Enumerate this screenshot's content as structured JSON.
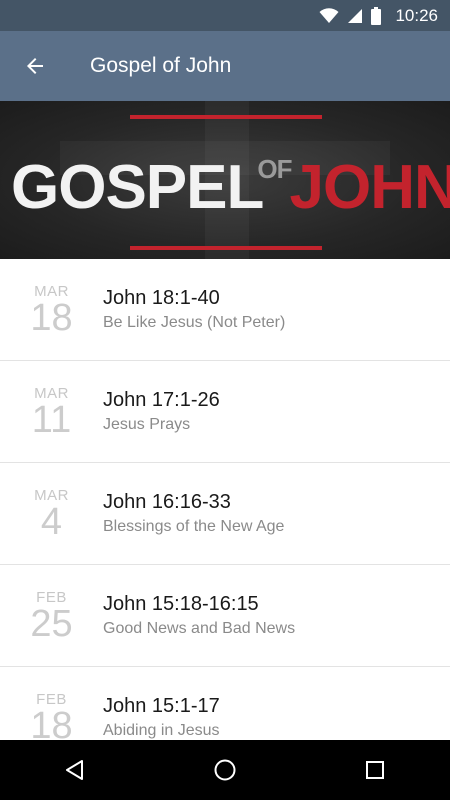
{
  "status_bar": {
    "time": "10:26",
    "icons": [
      "wifi-icon",
      "cell-signal-icon",
      "battery-icon"
    ]
  },
  "app_bar": {
    "title": "Gospel of John",
    "back_icon": "arrow-left-icon"
  },
  "banner": {
    "word1": "GOSPEL",
    "word2": "OF",
    "word3": "JOHN",
    "accent_color": "#c3232d"
  },
  "sermons": [
    {
      "month": "MAR",
      "day": "18",
      "reference": "John 18:1-40",
      "title": "Be Like Jesus (Not Peter)"
    },
    {
      "month": "MAR",
      "day": "11",
      "reference": "John 17:1-26",
      "title": "Jesus Prays"
    },
    {
      "month": "MAR",
      "day": "4",
      "reference": "John 16:16-33",
      "title": "Blessings of the New Age"
    },
    {
      "month": "FEB",
      "day": "25",
      "reference": "John 15:18-16:15",
      "title": "Good News and Bad News"
    },
    {
      "month": "FEB",
      "day": "18",
      "reference": "John 15:1-17",
      "title": "Abiding in Jesus"
    }
  ],
  "nav_bar": {
    "icons": [
      "back-triangle-icon",
      "home-circle-icon",
      "recents-square-icon"
    ]
  },
  "colors": {
    "status_bar": "#445566",
    "app_bar": "#5b7089",
    "accent_red": "#c3232d"
  }
}
